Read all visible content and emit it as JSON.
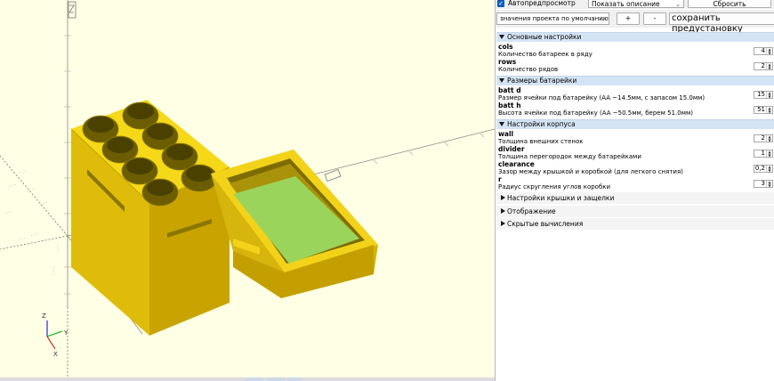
{
  "viewport": {
    "axes": {
      "z_label": "Z",
      "y_label": "Y",
      "x_label": "X"
    }
  },
  "colors": {
    "background": "#ffffe5",
    "model_yellow": "#f2d51c",
    "model_shadow": "#a88c00",
    "model_dark": "#4d4400",
    "green_face": "#9bd45a",
    "section_header": "#d5e4f5",
    "checkbox_blue": "#0a64c8"
  },
  "toolbar": {
    "autopreview_label": "Автопредпросмотр",
    "autopreview_checked": true,
    "description_select": "Показать описание",
    "reset_button": "Сбросить",
    "preset_select": "значения проекта по умолчанию",
    "add_button": "+",
    "remove_button": "-",
    "save_preset_button": "сохранить предустановку"
  },
  "sections": [
    {
      "title": "Основные настройки",
      "expanded": true,
      "params": [
        {
          "name": "cols",
          "desc": "Количество батареек в ряду",
          "value": "4"
        },
        {
          "name": "rows",
          "desc": "Количество рядов",
          "value": "2"
        }
      ]
    },
    {
      "title": "Размеры батарейки",
      "expanded": true,
      "params": [
        {
          "name": "batt d",
          "desc": "Размер ячейки под батарейку (AA ~14.5мм, с запасом 15.0мм)",
          "value": "15"
        },
        {
          "name": "batt h",
          "desc": "Высота ячейки под батарейку (AA ~50.5мм, берем 51.0мм)",
          "value": "51"
        }
      ]
    },
    {
      "title": "Настройки корпуса",
      "expanded": true,
      "params": [
        {
          "name": "wall",
          "desc": "Толщина внешних стенок",
          "value": "2"
        },
        {
          "name": "divider",
          "desc": "Толщина перегородок между батарейками",
          "value": "1"
        },
        {
          "name": "clearance",
          "desc": "Зазор между крышкой и коробкой (для легкого снятия)",
          "value": "0,2"
        },
        {
          "name": "r",
          "desc": "Радиус скругления углов коробки",
          "value": "3"
        }
      ]
    }
  ],
  "collapsed_sections": [
    {
      "title": "Настройки крышки и защелки"
    },
    {
      "title": "Отображение"
    },
    {
      "title": "Скрытые вычисления"
    }
  ]
}
